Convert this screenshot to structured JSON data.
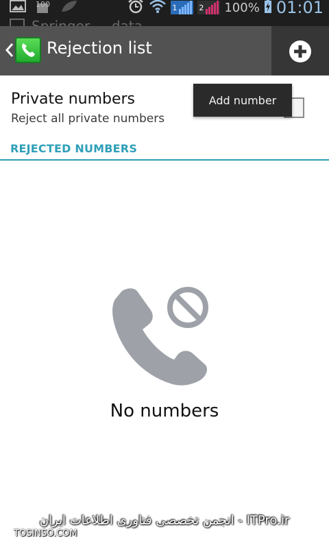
{
  "status_bar": {
    "notification_count": "100",
    "sim1_label": "1",
    "sim2_label": "2",
    "battery": "100%",
    "time": "01:01",
    "background_notification": "Springer ... data"
  },
  "action_bar": {
    "title": "Rejection list",
    "add_icon": "plus-circle-icon"
  },
  "popup": {
    "label": "Add number"
  },
  "private_numbers": {
    "title": "Private numbers",
    "summary": "Reject all private numbers",
    "checked": false
  },
  "section": {
    "header": "REJECTED NUMBERS"
  },
  "empty_state": {
    "icon": "blocked-phone-icon",
    "text": "No numbers"
  },
  "watermark": {
    "persian": "انجمن تخصصی فناوری اطلاعات ایران - ITPro.ir",
    "site": "TOSINSO.COM"
  },
  "colors": {
    "action_bar": "#525252",
    "accent": "#2f9fb8",
    "icon_gray": "#9ea2a8"
  }
}
